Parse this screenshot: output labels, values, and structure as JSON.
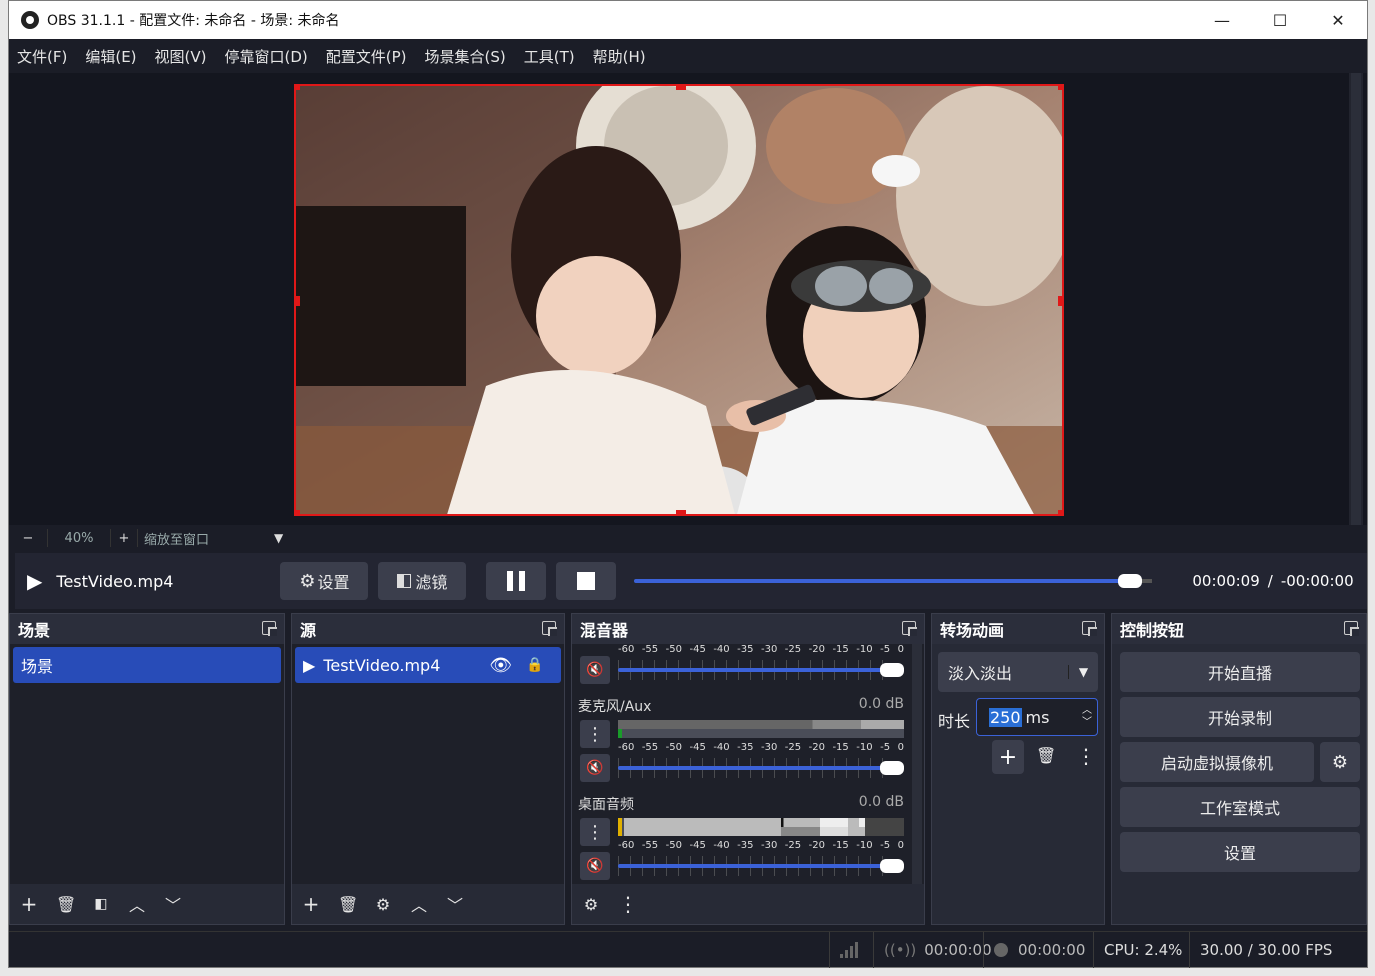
{
  "window": {
    "title": "OBS 31.1.1 - 配置文件: 未命名 - 场景: 未命名",
    "minimize": "—",
    "maximize": "☐",
    "close": "✕"
  },
  "menu": [
    "文件(F)",
    "编辑(E)",
    "视图(V)",
    "停靠窗口(D)",
    "配置文件(P)",
    "场景集合(S)",
    "工具(T)",
    "帮助(H)"
  ],
  "zoom": {
    "minus": "−",
    "value": "40%",
    "plus": "+",
    "fit": "缩放至窗口"
  },
  "media": {
    "file": "TestVideo.mp4",
    "settings": "设置",
    "filters": "滤镜",
    "progress": 0.98,
    "time": "00:00:09",
    "separator": "/",
    "remaining": "-00:00:00"
  },
  "scenes": {
    "title": "场景",
    "items": [
      "场景"
    ]
  },
  "sources": {
    "title": "源",
    "items": [
      "TestVideo.mp4"
    ]
  },
  "mixer": {
    "title": "混音器",
    "scale": [
      "-60",
      "-55",
      "-50",
      "-45",
      "-40",
      "-35",
      "-30",
      "-25",
      "-20",
      "-15",
      "-10",
      "-5",
      "0"
    ],
    "channels": [
      {
        "name": "麦克风/Aux",
        "db": "0.0 dB"
      },
      {
        "name": "桌面音频",
        "db": "0.0 dB"
      }
    ]
  },
  "transitions": {
    "title": "转场动画",
    "selected": "淡入淡出",
    "duration_label": "时长",
    "duration_value": "250",
    "duration_unit": "ms"
  },
  "controls": {
    "title": "控制按钮",
    "start_stream": "开始直播",
    "start_record": "开始录制",
    "virtual_cam": "启动虚拟摄像机",
    "studio_mode": "工作室模式",
    "settings": "设置"
  },
  "status": {
    "stream_time": "00:00:00",
    "record_time": "00:00:00",
    "cpu": "CPU: 2.4%",
    "fps": "30.00 / 30.00 FPS"
  },
  "colors": {
    "accent": "#284cb8",
    "selection": "#e01818",
    "background": "#1b1d27"
  }
}
